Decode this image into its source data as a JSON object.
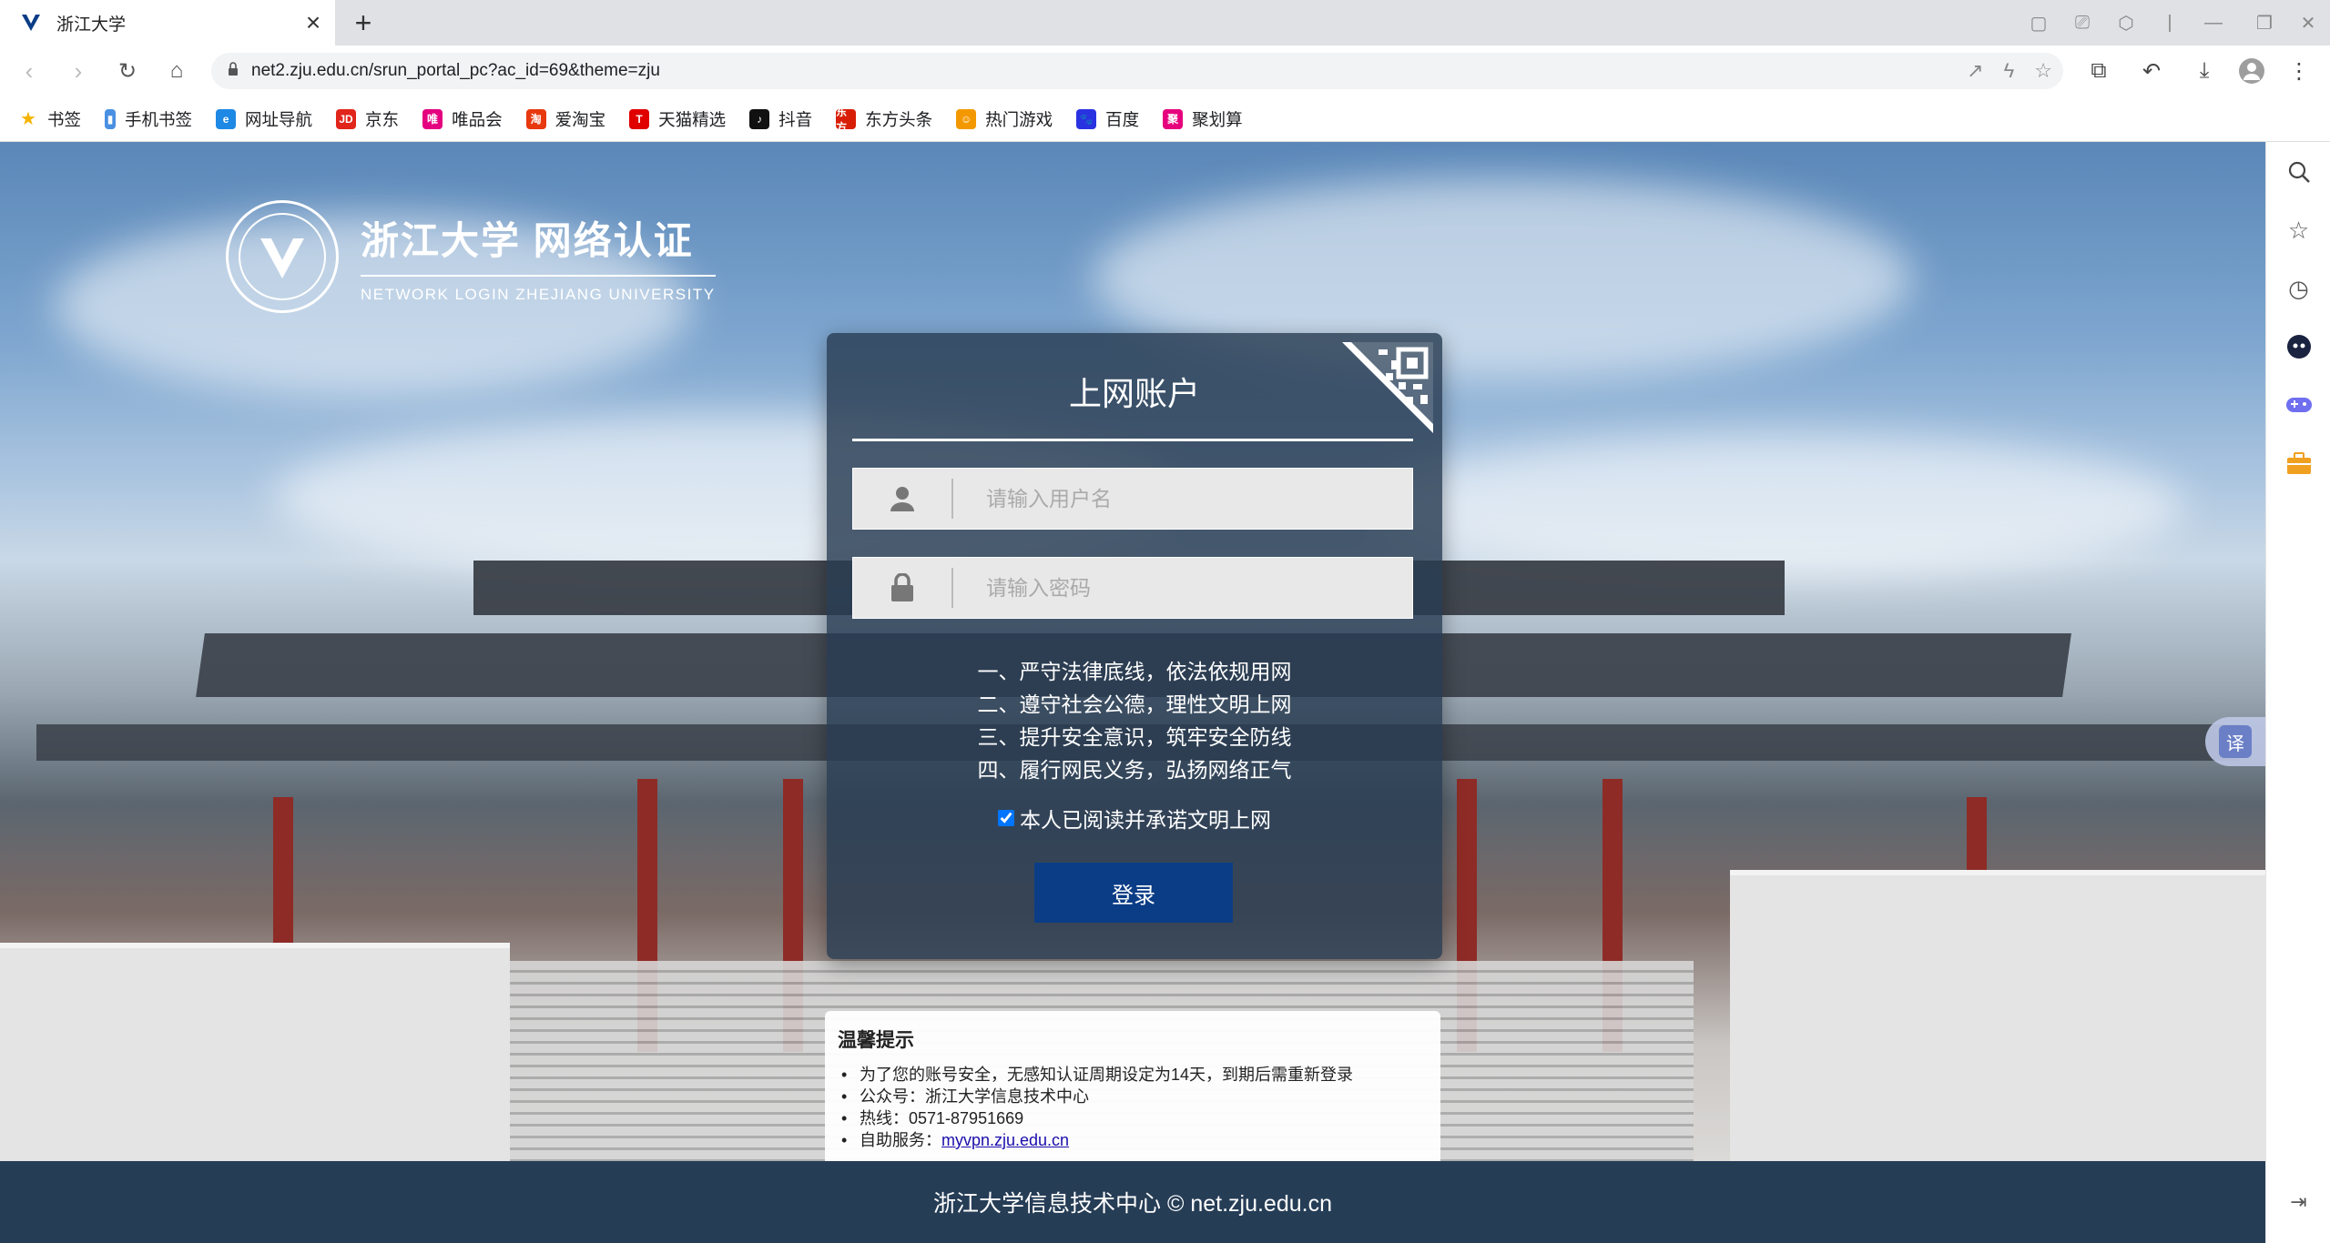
{
  "browser": {
    "tab_title": "浙江大学",
    "tab_close": "×",
    "new_tab": "+",
    "url": "net2.zju.edu.cn/srun_portal_pc?ac_id=69&theme=zju",
    "bookmarks": [
      {
        "label": "书签",
        "icon_color": "#f5b400",
        "glyph": "★"
      },
      {
        "label": "手机书签",
        "icon_color": "#4a90e2",
        "glyph": "▮"
      },
      {
        "label": "网址导航",
        "icon_color": "#1e88e5",
        "glyph": "e"
      },
      {
        "label": "京东",
        "icon_color": "#e1251b",
        "glyph": "JD"
      },
      {
        "label": "唯品会",
        "icon_color": "#e4007f",
        "glyph": "唯"
      },
      {
        "label": "爱淘宝",
        "icon_color": "#e8380d",
        "glyph": "淘"
      },
      {
        "label": "天猫精选",
        "icon_color": "#e00000",
        "glyph": "T"
      },
      {
        "label": "抖音",
        "icon_color": "#111111",
        "glyph": "♪"
      },
      {
        "label": "东方头条",
        "icon_color": "#d81e06",
        "glyph": "东方"
      },
      {
        "label": "热门游戏",
        "icon_color": "#f39800",
        "glyph": "☺"
      },
      {
        "label": "百度",
        "icon_color": "#2932e1",
        "glyph": "🐾"
      },
      {
        "label": "聚划算",
        "icon_color": "#e6007e",
        "glyph": "聚"
      }
    ]
  },
  "portal": {
    "logo_title": "浙江大学 网络认证",
    "logo_subtitle": "NETWORK LOGIN ZHEJIANG UNIVERSITY",
    "login_title": "上网账户",
    "username_placeholder": "请输入用户名",
    "password_placeholder": "请输入密码",
    "rules": [
      "一、严守法律底线，依法依规用网",
      "二、遵守社会公德，理性文明上网",
      "三、提升安全意识，筑牢安全防线",
      "四、履行网民义务，弘扬网络正气"
    ],
    "agree_label": "本人已阅读并承诺文明上网",
    "agree_checked": true,
    "login_button": "登录",
    "tips": {
      "title": "温馨提示",
      "items": [
        "为了您的账号安全，无感知认证周期设定为14天，到期后需重新登录",
        "公众号：浙江大学信息技术中心",
        "热线：0571-87951669"
      ],
      "self_service_prefix": "自助服务：",
      "self_service_link": "myvpn.zju.edu.cn"
    },
    "footer": "浙江大学信息技术中心 © net.zju.edu.cn",
    "translate_label": "译"
  }
}
